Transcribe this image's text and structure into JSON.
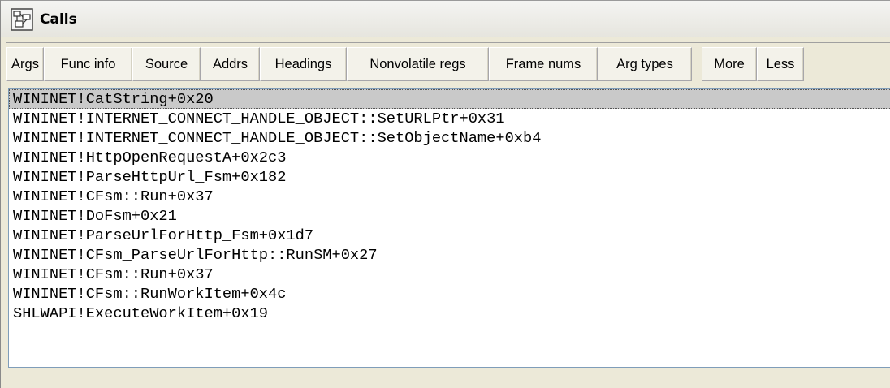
{
  "window": {
    "title": "Calls",
    "icon": "calls-window-icon"
  },
  "toolbar": {
    "buttons": [
      {
        "label": "Args"
      },
      {
        "label": "Func info"
      },
      {
        "label": "Source"
      },
      {
        "label": "Addrs"
      },
      {
        "label": "Headings"
      },
      {
        "label": "Nonvolatile regs"
      },
      {
        "label": "Frame nums"
      },
      {
        "label": "Arg types"
      },
      {
        "label": "More"
      },
      {
        "label": "Less"
      }
    ]
  },
  "calls": {
    "selected_index": 0,
    "rows": [
      "WININET!CatString+0x20",
      "WININET!INTERNET_CONNECT_HANDLE_OBJECT::SetURLPtr+0x31",
      "WININET!INTERNET_CONNECT_HANDLE_OBJECT::SetObjectName+0xb4",
      "WININET!HttpOpenRequestA+0x2c3",
      "WININET!ParseHttpUrl_Fsm+0x182",
      "WININET!CFsm::Run+0x37",
      "WININET!DoFsm+0x21",
      "WININET!ParseUrlForHttp_Fsm+0x1d7",
      "WININET!CFsm_ParseUrlForHttp::RunSM+0x27",
      "WININET!CFsm::Run+0x37",
      "WININET!CFsm::RunWorkItem+0x4c",
      "SHLWAPI!ExecuteWorkItem+0x19"
    ]
  },
  "colors": {
    "window_bg": "#ece9d8",
    "selection": "#c9c9c9",
    "list_border": "#7f9db9"
  }
}
